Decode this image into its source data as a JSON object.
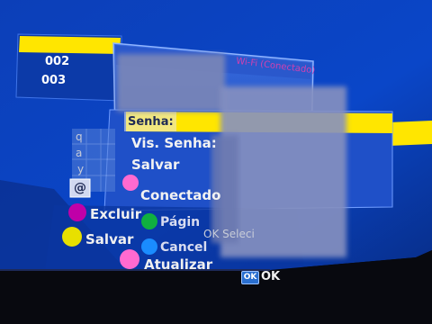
{
  "channel_list": {
    "items": [
      "002",
      "003"
    ]
  },
  "wifi_dialog": {
    "title": "Wi-Fi (Conectado)",
    "fields": {
      "password": "Senha:",
      "show_password": "Vis. Senha:",
      "save": "Salvar"
    },
    "status": "Conectado"
  },
  "keyboard": {
    "keys": [
      "q",
      "a",
      "y",
      "@"
    ]
  },
  "buttons": {
    "delete": "Excluir",
    "page": "Págin",
    "ok_select": "OK Seleci",
    "save": "Salvar",
    "cancel": "Cancel",
    "refresh": "Atualizar",
    "ok": "OK"
  },
  "colors": {
    "background": "#0a3fb8",
    "dialog": "#2a5fd0",
    "highlight_yellow": "#ffe600",
    "btn_magenta": "#c000a8",
    "btn_green": "#10b040",
    "btn_yellow": "#e8e000",
    "btn_blue": "#1a8cff",
    "btn_pink": "#ff6ad0"
  }
}
